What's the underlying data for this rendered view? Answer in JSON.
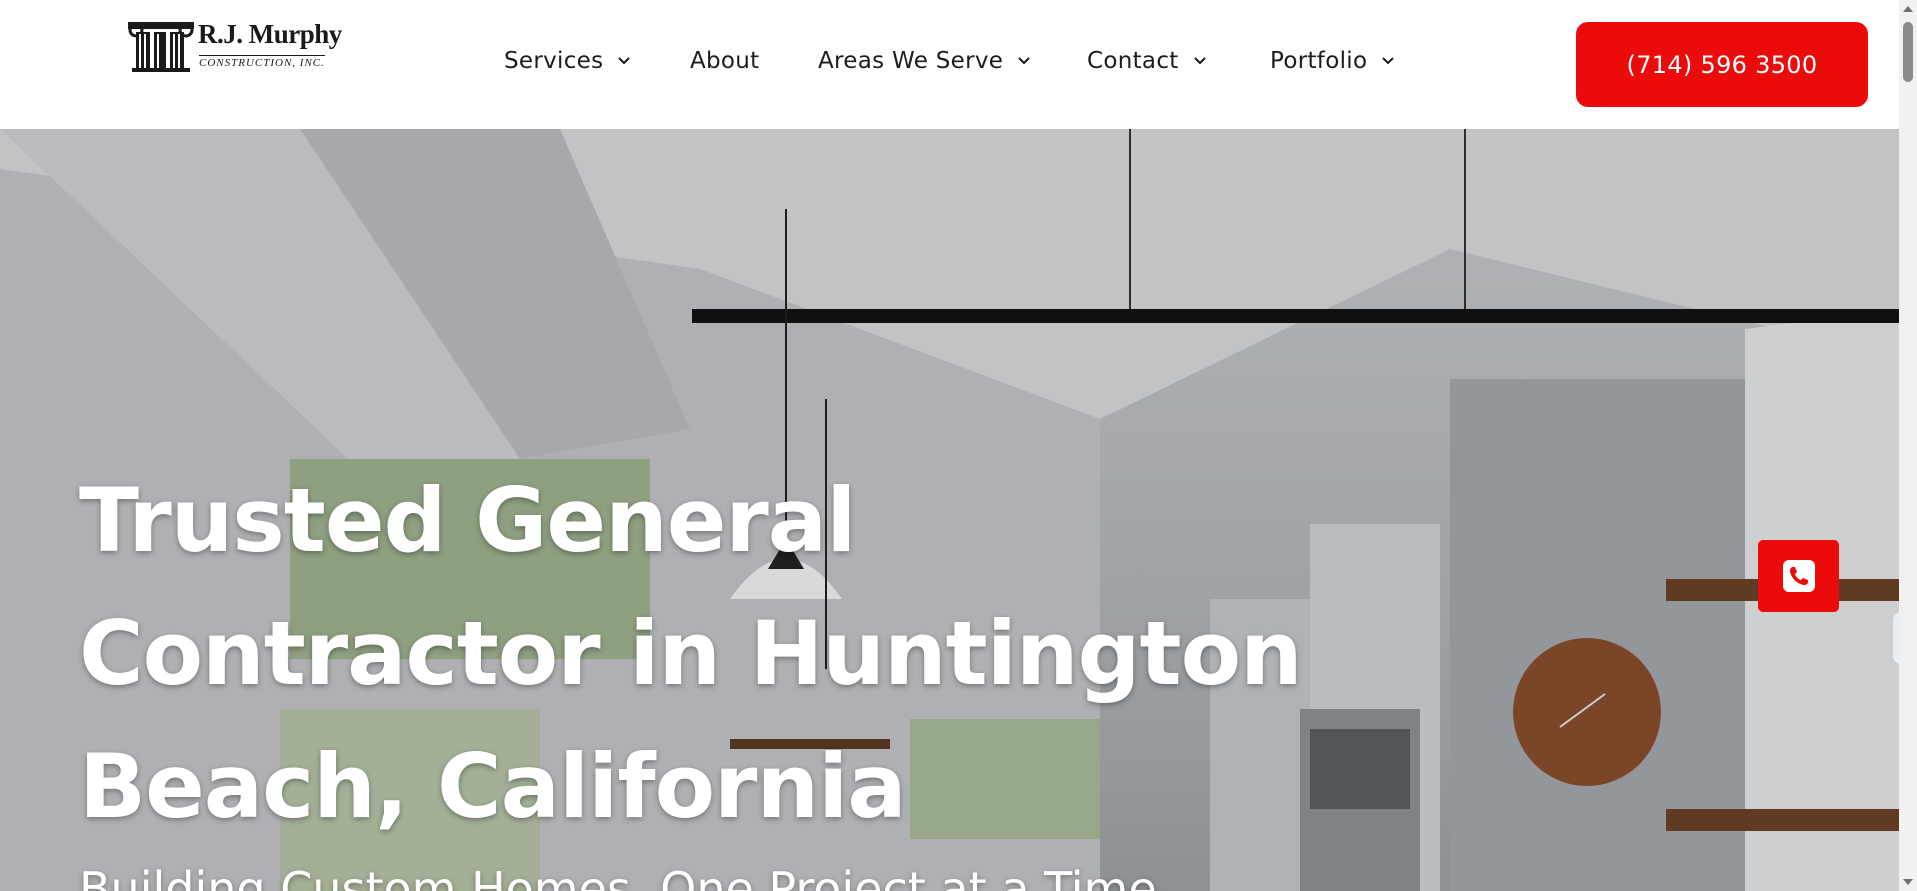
{
  "logo": {
    "name": "R.J. Murphy",
    "subtitle": "CONSTRUCTION, INC."
  },
  "nav": {
    "items": [
      {
        "label": "Services",
        "has_dropdown": true
      },
      {
        "label": "About",
        "has_dropdown": false
      },
      {
        "label": "Areas We Serve",
        "has_dropdown": true
      },
      {
        "label": "Contact",
        "has_dropdown": true
      },
      {
        "label": "Portfolio",
        "has_dropdown": true
      }
    ],
    "phone_button": "(714) 596 3500"
  },
  "hero": {
    "title": "Trusted General Contractor in Huntington Beach, California",
    "subtitle": "Building Custom Homes, One Project at a Time"
  },
  "floating": {
    "call_icon": "phone-icon",
    "side_tab_icon": "chevron-left-icon"
  },
  "colors": {
    "accent": "#ec0b0b",
    "text_dark": "#1c1c1c",
    "side_tab_arrow": "#2a7bd4"
  }
}
